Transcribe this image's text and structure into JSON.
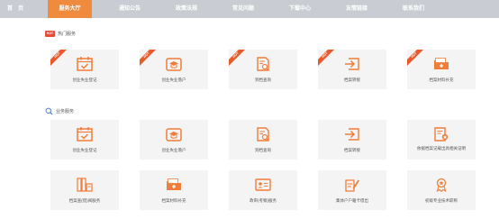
{
  "nav": {
    "items": [
      {
        "label": "首　页"
      },
      {
        "label": "服务大厅"
      },
      {
        "label": "通知公告"
      },
      {
        "label": "政策法规"
      },
      {
        "label": "常见问题"
      },
      {
        "label": "下载中心"
      },
      {
        "label": "友情链接"
      },
      {
        "label": "联系我们"
      }
    ],
    "active_index": 1
  },
  "hot_section": {
    "badge": "HOT",
    "title": "热门服务",
    "ribbon_text": "HOT",
    "cards": [
      {
        "label": "创业失业登记",
        "icon": "calendar-check-icon"
      },
      {
        "label": "创业失业落户",
        "icon": "graduation-cap-icon"
      },
      {
        "label": "到档查询",
        "icon": "document-search-icon"
      },
      {
        "label": "档案转接",
        "icon": "transfer-in-icon"
      },
      {
        "label": "档案材料补充",
        "icon": "folder-add-icon"
      }
    ]
  },
  "all_section": {
    "title": "业务服务",
    "cards": [
      {
        "label": "创业失业登记",
        "icon": "calendar-check-icon"
      },
      {
        "label": "创业失业落户",
        "icon": "graduation-cap-icon"
      },
      {
        "label": "到档查询",
        "icon": "document-search-icon"
      },
      {
        "label": "档案转接",
        "icon": "transfer-in-icon"
      },
      {
        "label": "依据档案记载出具相关证明",
        "icon": "certificate-icon"
      },
      {
        "label": "档案查(借)阅服务",
        "icon": "book-stack-icon"
      },
      {
        "label": "档案材料补充",
        "icon": "folder-add-icon"
      },
      {
        "label": "政审(考察)服务",
        "icon": "id-card-icon"
      },
      {
        "label": "集体户户籍卡借出",
        "icon": "edit-card-icon"
      },
      {
        "label": "初级专业技术职称",
        "icon": "award-icon"
      }
    ]
  },
  "colors": {
    "accent": "#f08a3c",
    "icon": "#f07d3a",
    "hot": "#e64b3b",
    "nav_bg": "#c9cdd3",
    "card_bg": "#f4f4f4"
  }
}
